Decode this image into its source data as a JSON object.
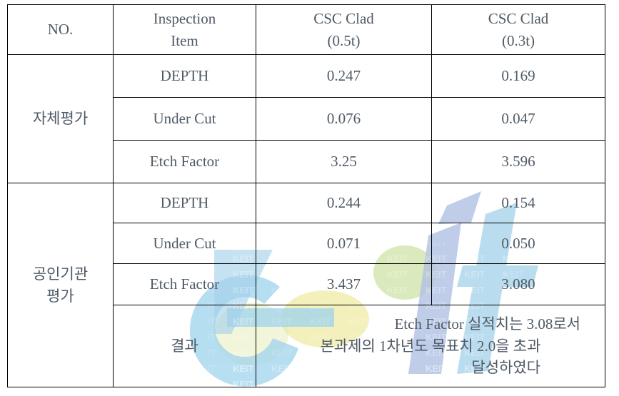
{
  "table": {
    "headers": [
      {
        "label": "NO.",
        "lines": [
          "NO."
        ]
      },
      {
        "label": "Inspection Item",
        "lines": [
          "Inspection",
          "Item"
        ]
      },
      {
        "label": "CSC Clad (0.5t)",
        "lines": [
          "CSC Clad",
          "(0.5t)"
        ]
      },
      {
        "label": "CSC Clad (0.3t)",
        "lines": [
          "CSC Clad",
          "(0.3t)"
        ]
      }
    ],
    "groups": [
      {
        "name": "자체평가",
        "rows": [
          {
            "item": "DEPTH",
            "csc_05t": "0.247",
            "csc_03t": "0.169",
            "highlight_05t": false,
            "highlight_03t": false
          },
          {
            "item": "Under Cut",
            "csc_05t": "0.076",
            "csc_03t": "0.047",
            "highlight_05t": false,
            "highlight_03t": false
          },
          {
            "item": "Etch Factor",
            "csc_05t": "3.25",
            "csc_03t": "3.596",
            "highlight_05t": false,
            "highlight_03t": true
          }
        ]
      },
      {
        "name": "공인기관 평가",
        "name_lines": [
          "공인기관",
          "평가"
        ],
        "rows": [
          {
            "item": "DEPTH",
            "csc_05t": "0.244",
            "csc_03t": "0.154",
            "highlight_05t": false,
            "highlight_03t": false
          },
          {
            "item": "Under Cut",
            "csc_05t": "0.071",
            "csc_03t": "0.050",
            "highlight_05t": false,
            "highlight_03t": false
          },
          {
            "item": "Etch Factor",
            "csc_05t": "3.437",
            "csc_03t": "3.080",
            "highlight_05t": false,
            "highlight_03t": true
          }
        ],
        "result": {
          "item": "결과",
          "lines": [
            "Etch Factor 실적치는 3.08로서",
            "본과제의 1차년도 목표치 2.0을 초과",
            "달성하였다"
          ]
        }
      }
    ]
  },
  "watermark": {
    "logo_text": "eit",
    "tile_text": "KEIT",
    "colors": {
      "blue": "#8ec6e6",
      "green": "#bcd98a",
      "yellow": "#ece98a",
      "navy": "#8e9fd0"
    }
  },
  "colors": {
    "header_background": "#faf6c6",
    "highlight_background": "#faf4c0",
    "border": "#000000",
    "text": "#4f5a66"
  }
}
